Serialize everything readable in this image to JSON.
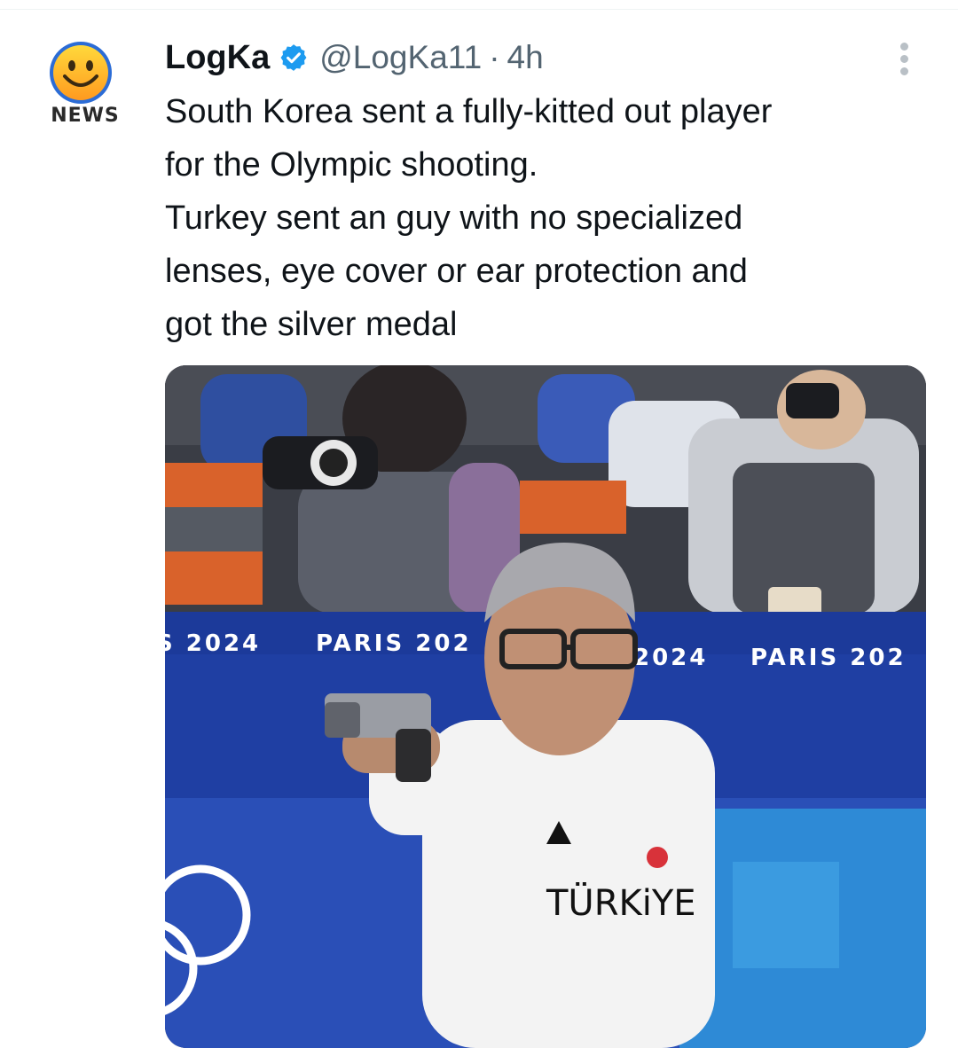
{
  "avatar": {
    "label": "NEWS"
  },
  "author": {
    "display_name": "LogKa",
    "handle": "@LogKa11",
    "separator": "·",
    "timestamp": "4h",
    "verified": true
  },
  "tweet": {
    "text_lines": [
      "South Korea sent a fully-kitted out player",
      "for the Olympic shooting.",
      "Turkey sent an guy with no specialized",
      "lenses, eye cover or ear protection and",
      "got the silver medal"
    ]
  },
  "media": {
    "banner_texts": [
      "S 2024",
      "PARIS 202",
      "2024",
      "PARIS 202"
    ],
    "shirt_text": "TÜRKiYE"
  },
  "colors": {
    "text_primary": "#0f1419",
    "text_secondary": "#536471",
    "verified_blue": "#1d9bf0",
    "banner_blue": "#1f3fa3"
  },
  "icons": {
    "verified": "verified-badge-icon",
    "more": "more-vertical-icon"
  }
}
